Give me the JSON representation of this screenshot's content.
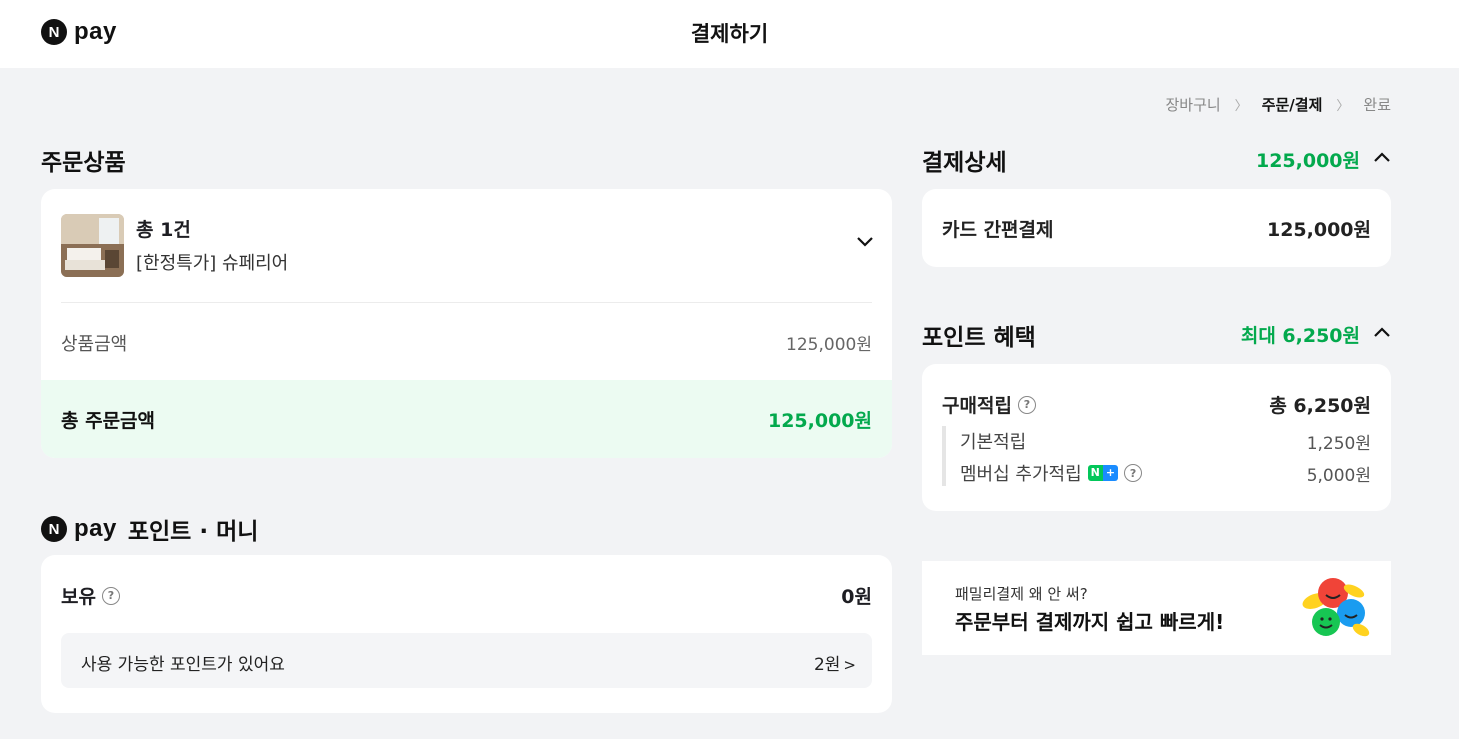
{
  "header": {
    "logo_n": "N",
    "logo_text": "pay",
    "title": "결제하기"
  },
  "breadcrumb": {
    "step1": "장바구니",
    "step2": "주문/결제",
    "step3": "완료"
  },
  "order": {
    "section_title": "주문상품",
    "count": "총 1건",
    "product_name": "[한정특가] 슈페리어",
    "product_price_label": "상품금액",
    "product_price_value": "125,000원",
    "total_label": "총 주문금액",
    "total_value": "125,000원"
  },
  "npay_points": {
    "logo_n": "N",
    "logo_text": "pay",
    "section_title": "포인트 · 머니",
    "hold_label": "보유",
    "hold_value": "0원",
    "available_text": "사용 가능한 포인트가 있어요",
    "available_value": "2원"
  },
  "payment_detail": {
    "section_title": "결제상세",
    "header_value": "125,000원",
    "method_label": "카드 간편결제",
    "method_value": "125,000원"
  },
  "benefit": {
    "section_title": "포인트 혜택",
    "header_value": "최대 6,250원",
    "main_label": "구매적립",
    "main_value": "총 6,250원",
    "basic_label": "기본적립",
    "basic_value": "1,250원",
    "member_label": "멤버십 추가적립",
    "member_badge_n": "N",
    "member_badge_plus": "+",
    "member_value": "5,000원"
  },
  "banner": {
    "sub": "패밀리결제 왜 안 써?",
    "main": "주문부터 결제까지 쉽고 빠르게!"
  },
  "colors": {
    "accent_green": "#03a94d",
    "band_green": "#ecfbf2",
    "page_bg": "#f2f3f5"
  }
}
